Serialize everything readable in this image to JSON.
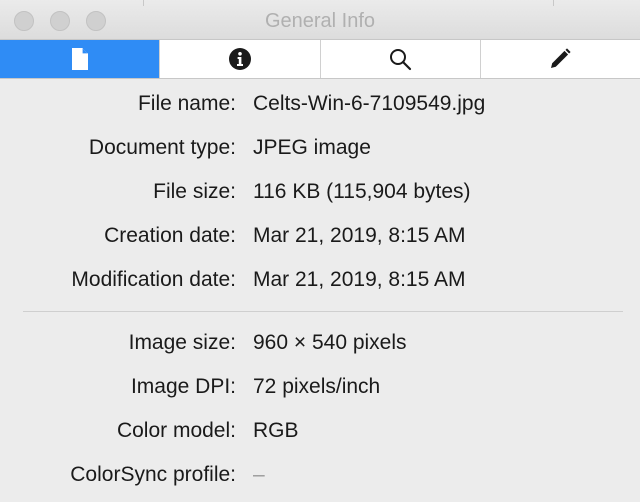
{
  "window": {
    "title": "General Info"
  },
  "tabs": [
    {
      "icon": "document-icon",
      "active": true
    },
    {
      "icon": "info-icon",
      "active": false
    },
    {
      "icon": "magnifier-icon",
      "active": false
    },
    {
      "icon": "pencil-icon",
      "active": false
    }
  ],
  "colors": {
    "accent": "#2f8cf5",
    "background": "#ececec"
  },
  "file_info": [
    {
      "label": "File name:",
      "value": "Celts-Win-6-7109549.jpg"
    },
    {
      "label": "Document type:",
      "value": "JPEG image"
    },
    {
      "label": "File size:",
      "value": "116 KB (115,904 bytes)"
    },
    {
      "label": "Creation date:",
      "value": "Mar 21, 2019, 8:15 AM"
    },
    {
      "label": "Modification date:",
      "value": "Mar 21, 2019, 8:15 AM"
    }
  ],
  "image_info": [
    {
      "label": "Image size:",
      "value": "960 × 540 pixels"
    },
    {
      "label": "Image DPI:",
      "value": "72 pixels/inch"
    },
    {
      "label": "Color model:",
      "value": "RGB"
    },
    {
      "label": "ColorSync profile:",
      "value": "–"
    }
  ]
}
